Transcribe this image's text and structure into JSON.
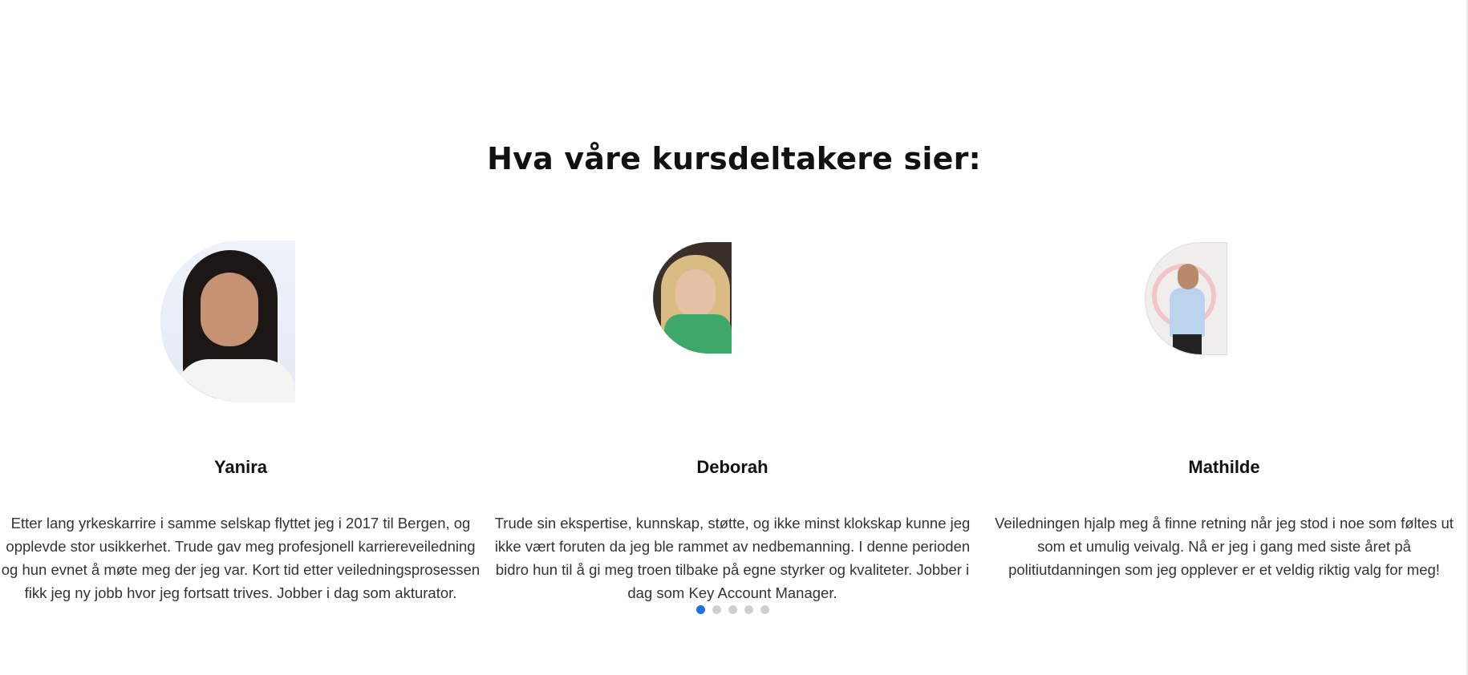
{
  "section": {
    "title": "Hva våre kursdeltakere sier:"
  },
  "testimonials": [
    {
      "name": "Yanira",
      "quote": "Etter lang yrkeskarrire i samme selskap flyttet jeg i 2017 til Bergen, og opplevde stor usikkerhet. Trude gav meg profesjonell karriereveiledning og hun evnet å møte meg der jeg var. Kort tid etter veiledningsprosessen fikk jeg ny jobb hvor jeg fortsatt trives. Jobber i dag som akturator."
    },
    {
      "name": "Deborah",
      "quote": "Trude sin ekspertise, kunnskap, støtte, og ikke minst klokskap kunne jeg ikke vært foruten da jeg ble rammet av nedbemanning. I denne perioden bidro hun til å gi meg troen tilbake på egne styrker og kvaliteter. Jobber i dag som Key Account Manager."
    },
    {
      "name": "Mathilde",
      "quote": "Veiledningen hjalp meg å finne retning når jeg stod i noe som føltes ut som et umulig veivalg. Nå er jeg i gang med siste året på politiutdanningen som jeg opplever er et veldig riktig valg for meg!"
    }
  ],
  "carousel": {
    "total_pages": 5,
    "active_page": 1,
    "active_color": "#1f6fdc",
    "inactive_color": "#cfcfcf"
  }
}
